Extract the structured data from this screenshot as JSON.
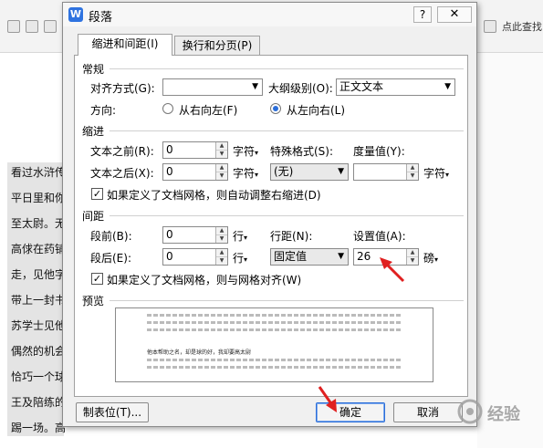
{
  "background": {
    "search_text": "点此查找",
    "doc_lines": [
      "看过水浒传",
      "平日里和你",
      "至太尉。无",
      "高俅在药铺",
      "走，见他字",
      "带上一封书",
      "苏学士见他",
      "偶然的机会",
      "恰巧一个球",
      "王及陪练的",
      "踢一场。高"
    ]
  },
  "dialog": {
    "title": "段落",
    "app_icon": "W",
    "help_label": "?",
    "close_label": "✕",
    "tabs": [
      {
        "label": "缩进和间距(I)"
      },
      {
        "label": "换行和分页(P)"
      }
    ],
    "general": {
      "section": "常规",
      "alignment_label": "对齐方式(G):",
      "alignment_value": "",
      "outline_label": "大纲级别(O):",
      "outline_value": "正文文本",
      "direction_label": "方向:",
      "rtl_label": "从右向左(F)",
      "ltr_label": "从左向右(L)",
      "direction_selected": "ltr"
    },
    "indent": {
      "section": "缩进",
      "before_label": "文本之前(R):",
      "before_value": "0",
      "before_unit": "字符",
      "after_label": "文本之后(X):",
      "after_value": "0",
      "after_unit": "字符",
      "special_label": "特殊格式(S):",
      "special_value": "(无)",
      "measure_label": "度量值(Y):",
      "measure_value": "",
      "measure_unit": "字符",
      "auto_adjust_label": "如果定义了文档网格，则自动调整右缩进(D)",
      "auto_adjust_checked": true
    },
    "spacing": {
      "section": "间距",
      "before_label": "段前(B):",
      "before_value": "0",
      "before_unit": "行",
      "after_label": "段后(E):",
      "after_value": "0",
      "after_unit": "行",
      "line_label": "行距(N):",
      "line_value": "固定值",
      "setvalue_label": "设置值(A):",
      "setvalue_value": "26",
      "setvalue_unit": "磅",
      "grid_align_label": "如果定义了文档网格，则与网格对齐(W)",
      "grid_align_checked": true
    },
    "preview": {
      "section": "预览",
      "sample_text": "他本帮助之名，却是球的好，我却要高太尉"
    },
    "buttons": {
      "tabs_label": "制表位(T)...",
      "ok_label": "确定",
      "cancel_label": "取消"
    }
  },
  "watermark": {
    "text": "经验"
  }
}
